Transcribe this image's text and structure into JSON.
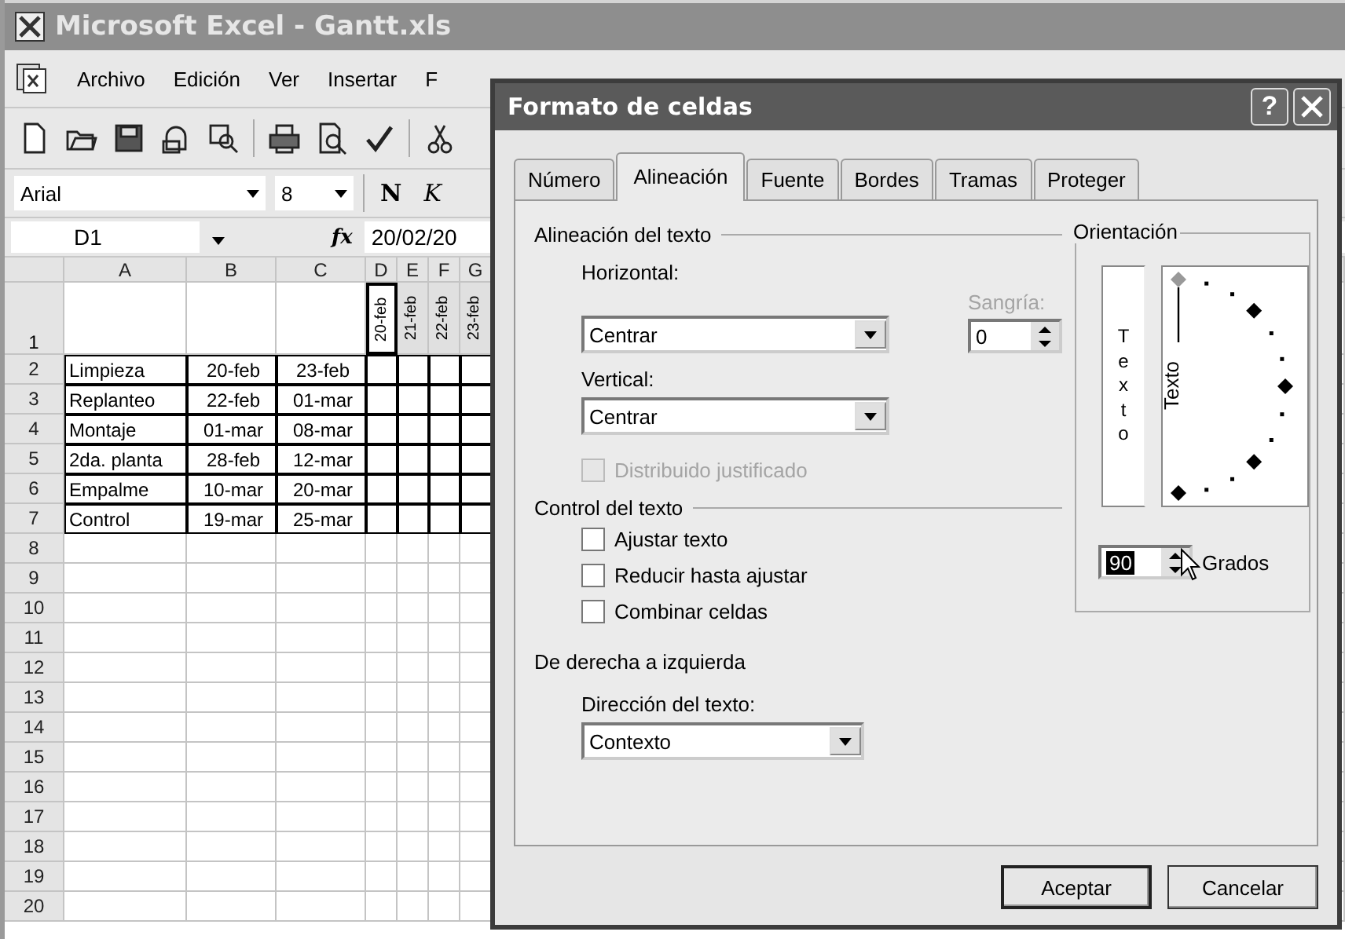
{
  "window": {
    "title": "Microsoft Excel - Gantt.xls"
  },
  "menu": [
    "Archivo",
    "Edición",
    "Ver",
    "Insertar",
    "F"
  ],
  "format_bar": {
    "font": "Arial",
    "size": "8",
    "bold": "N",
    "italic": "K"
  },
  "formula_bar": {
    "name_box": "D1",
    "fx": "fx",
    "formula": "20/02/20"
  },
  "sheet": {
    "columns": [
      "A",
      "B",
      "C",
      "D",
      "E",
      "F",
      "G"
    ],
    "header_row": {
      "number": "1",
      "cells": [
        {
          "text": "20-feb",
          "selected": true
        },
        {
          "text": "21-feb",
          "selected": false
        },
        {
          "text": "22-feb",
          "selected": false
        },
        {
          "text": "23-feb",
          "selected": false
        }
      ]
    },
    "rows": [
      {
        "number": "2",
        "cells": [
          "Limpieza",
          "20-feb",
          "23-feb"
        ]
      },
      {
        "number": "3",
        "cells": [
          "Replanteo",
          "22-feb",
          "01-mar"
        ]
      },
      {
        "number": "4",
        "cells": [
          "Montaje",
          "01-mar",
          "08-mar"
        ]
      },
      {
        "number": "5",
        "cells": [
          "2da. planta",
          "28-feb",
          "12-mar"
        ]
      },
      {
        "number": "6",
        "cells": [
          "Empalme",
          "10-mar",
          "20-mar"
        ]
      },
      {
        "number": "7",
        "cells": [
          "Control",
          "19-mar",
          "25-mar"
        ]
      }
    ],
    "empty_rows": [
      "8",
      "9",
      "10",
      "11",
      "12",
      "13",
      "14",
      "15",
      "16",
      "17",
      "18",
      "19",
      "20"
    ]
  },
  "dialog": {
    "title": "Formato de celdas",
    "help": "?",
    "tabs": [
      {
        "label": "Número",
        "selected": false
      },
      {
        "label": "Alineación",
        "selected": true
      },
      {
        "label": "Fuente",
        "selected": false
      },
      {
        "label": "Bordes",
        "selected": false
      },
      {
        "label": "Tramas",
        "selected": false
      },
      {
        "label": "Proteger",
        "selected": false
      }
    ],
    "text_alignment": {
      "title": "Alineación del texto",
      "horizontal": {
        "label": "Horizontal:",
        "value": "Centrar"
      },
      "vertical": {
        "label": "Vertical:",
        "value": "Centrar"
      },
      "indent": {
        "label": "Sangría:",
        "value": "0",
        "disabled": true
      },
      "distributed": {
        "label": "Distribuido justificado",
        "checked": false,
        "disabled": true
      }
    },
    "text_control": {
      "title": "Control del texto",
      "options": [
        {
          "label": "Ajustar texto",
          "checked": false
        },
        {
          "label": "Reducir hasta ajustar",
          "checked": false
        },
        {
          "label": "Combinar celdas",
          "checked": false
        }
      ]
    },
    "rtl": {
      "title": "De derecha a izquierda",
      "direction": {
        "label": "Dirección del texto:",
        "value": "Contexto"
      }
    },
    "orientation": {
      "title": "Orientación",
      "vertical_text": "Texto",
      "dial_text": "Texto",
      "degrees": "90",
      "degrees_label": "Grados"
    },
    "buttons": [
      "Aceptar",
      "Cancelar"
    ]
  }
}
